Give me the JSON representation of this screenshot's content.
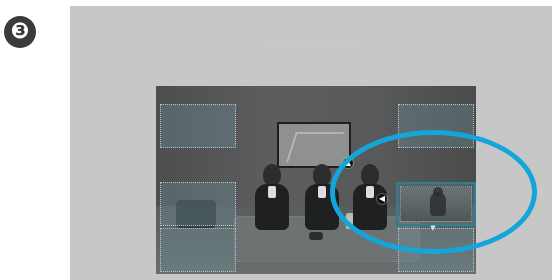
{
  "step": {
    "number": "❸"
  },
  "screen": {
    "title": "· · · · · · · · · · · · · · ·"
  },
  "controls": {
    "up_arrow": "▲",
    "left_arrow": "◀",
    "down_arrow": "▼"
  },
  "colors": {
    "badge": "#3b3b3b",
    "screen_bg": "#c7c7c7",
    "highlight": "#14a6db",
    "selected_border": "#2f7f92"
  }
}
